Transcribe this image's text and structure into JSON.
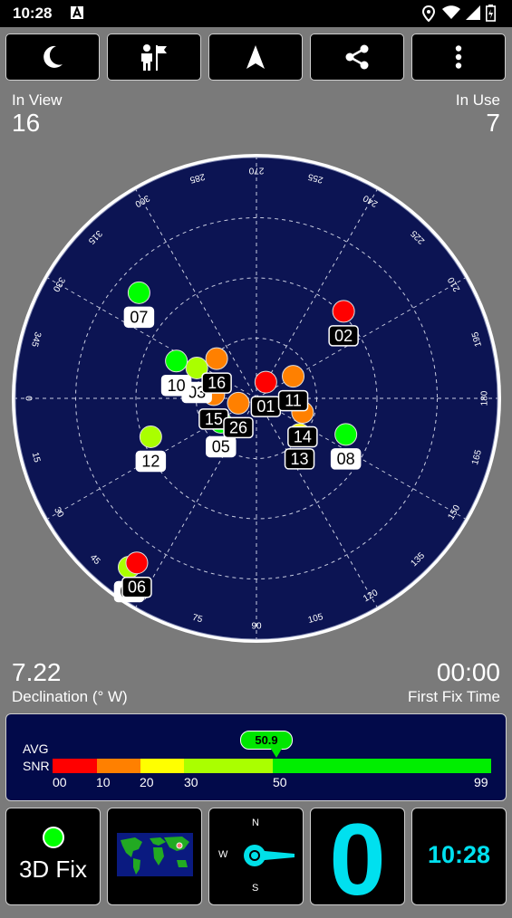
{
  "status_bar": {
    "time": "10:28"
  },
  "toolbar": [
    {
      "name": "night-mode-button",
      "icon": "moon-icon"
    },
    {
      "name": "person-flag-button",
      "icon": "person-flag-icon"
    },
    {
      "name": "navigation-button",
      "icon": "navigation-arrow-icon"
    },
    {
      "name": "share-button",
      "icon": "share-icon"
    },
    {
      "name": "more-options-button",
      "icon": "more-vert-icon"
    }
  ],
  "summary": {
    "in_view_label": "In View",
    "in_view_value": "16",
    "in_use_label": "In Use",
    "in_use_value": "7"
  },
  "skyplot": {
    "azimuth_labels": [
      "90",
      "105",
      "120",
      "135",
      "150",
      "165",
      "180",
      "195",
      "210",
      "225",
      "240",
      "255",
      "270",
      "285",
      "300",
      "315",
      "330",
      "345",
      "0",
      "15",
      "30",
      "45",
      "60",
      "75"
    ],
    "colors": {
      "red": "#ff0000",
      "orange": "#ff8000",
      "yellow": "#ffff00",
      "lime": "#aaff00",
      "green": "#00ff00"
    },
    "satellites": [
      {
        "id": "09",
        "azimuth": 53,
        "elevation": 11,
        "color": "lime"
      },
      {
        "id": "06",
        "azimuth": 54,
        "elevation": 14,
        "color": "red"
      },
      {
        "id": "12",
        "azimuth": 20,
        "elevation": 48,
        "color": "lime"
      },
      {
        "id": "08",
        "azimuth": 158,
        "elevation": 54,
        "color": "green"
      },
      {
        "id": "13",
        "azimuth": 140,
        "elevation": 69,
        "color": "yellow"
      },
      {
        "id": "14",
        "azimuth": 163,
        "elevation": 72,
        "color": "orange"
      },
      {
        "id": "05",
        "azimuth": 34,
        "elevation": 74,
        "color": "green"
      },
      {
        "id": "15",
        "azimuth": 355,
        "elevation": 74,
        "color": "orange"
      },
      {
        "id": "26",
        "azimuth": 15,
        "elevation": 83,
        "color": "orange"
      },
      {
        "id": "01",
        "azimuth": 240,
        "elevation": 83,
        "color": "red"
      },
      {
        "id": "11",
        "azimuth": 211,
        "elevation": 74,
        "color": "orange"
      },
      {
        "id": "03",
        "azimuth": 333,
        "elevation": 65,
        "color": "lime"
      },
      {
        "id": "10",
        "azimuth": 335,
        "elevation": 57,
        "color": "green"
      },
      {
        "id": "16",
        "azimuth": 315,
        "elevation": 69,
        "color": "orange"
      },
      {
        "id": "02",
        "azimuth": 225,
        "elevation": 44,
        "color": "red"
      },
      {
        "id": "07",
        "azimuth": 318,
        "elevation": 31,
        "color": "green"
      }
    ]
  },
  "declination": {
    "value": "7.22",
    "label": "Declination (° W)"
  },
  "first_fix": {
    "value": "00:00",
    "label": "First Fix Time"
  },
  "snr": {
    "label_avg": "AVG",
    "label_snr": "SNR",
    "average": "50.9",
    "ticks": [
      "00",
      "10",
      "20",
      "30",
      "50",
      "99"
    ]
  },
  "bottom": {
    "fix_label": "3D Fix",
    "compass": {
      "n": "N",
      "s": "S",
      "w": "W"
    },
    "satellites_in_use": "0",
    "clock": "10:28"
  }
}
